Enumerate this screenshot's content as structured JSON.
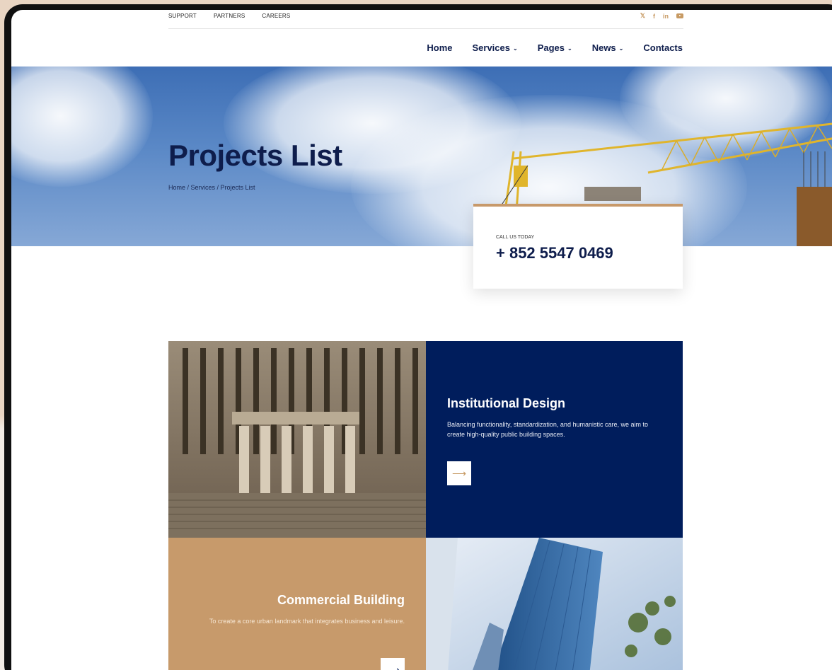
{
  "topbar": {
    "links": [
      "SUPPORT",
      "PARTNERS",
      "CAREERS"
    ],
    "social": [
      "twitter-icon",
      "facebook-icon",
      "linkedin-icon",
      "youtube-icon"
    ]
  },
  "nav": {
    "home": "Home",
    "services": "Services",
    "pages": "Pages",
    "news": "News",
    "contacts": "Contacts"
  },
  "hero": {
    "title": "Projects List",
    "breadcrumb": "Home / Services / Projects List"
  },
  "call": {
    "label": "CALL US TODAY",
    "phone": "+ 852 5547 0469"
  },
  "projects": [
    {
      "title": "Institutional Design",
      "description": "Balancing functionality, standardization, and humanistic care, we aim to create high-quality public building spaces."
    },
    {
      "title": "Commercial Building",
      "description": "To create a core urban landmark that integrates business and leisure."
    }
  ],
  "colors": {
    "navy": "#0e1d4c",
    "accent": "#c79a63",
    "panel_navy": "#001d5c",
    "panel_tan": "#c79a6b"
  }
}
